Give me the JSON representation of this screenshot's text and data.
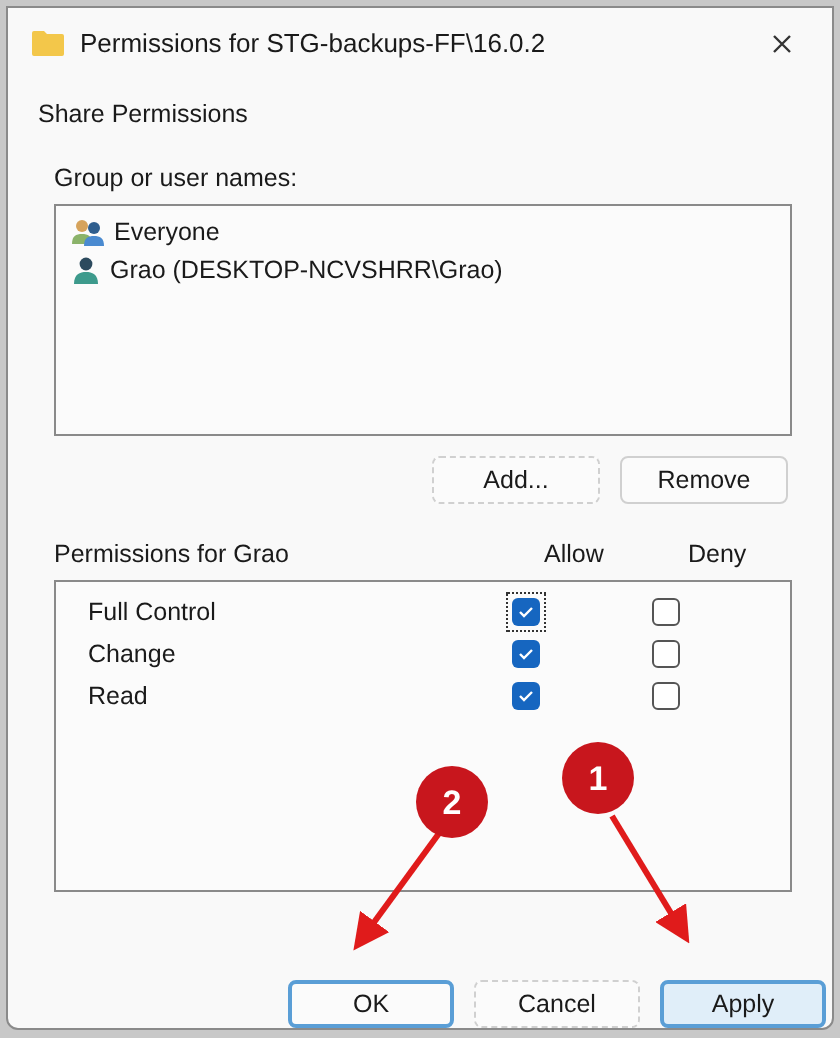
{
  "window": {
    "title": "Permissions for STG-backups-FF\\16.0.2"
  },
  "section_title": "Share Permissions",
  "users": {
    "label": "Group or user names:",
    "items": [
      {
        "kind": "group",
        "name": "Everyone",
        "selected": false
      },
      {
        "kind": "user",
        "name": "Grao (DESKTOP-NCVSHRR\\Grao)",
        "selected": false
      }
    ],
    "buttons": [
      {
        "label": "Add...",
        "kind": "plain"
      },
      {
        "label": "Remove",
        "kind": "normal"
      }
    ]
  },
  "permissions": {
    "label": "Permissions for Grao",
    "columns": [
      "Allow",
      "Deny"
    ],
    "rows": [
      {
        "name": "Full Control",
        "allow": true,
        "deny": false,
        "focused": true
      },
      {
        "name": "Change",
        "allow": true,
        "deny": false,
        "focused": false
      },
      {
        "name": "Read",
        "allow": true,
        "deny": false,
        "focused": false
      }
    ]
  },
  "buttons": [
    {
      "label": "OK",
      "kind": "default"
    },
    {
      "label": "Cancel",
      "kind": "plain"
    },
    {
      "label": "Apply",
      "kind": "hover"
    }
  ],
  "callouts": [
    {
      "number": "2"
    },
    {
      "number": "1"
    }
  ]
}
